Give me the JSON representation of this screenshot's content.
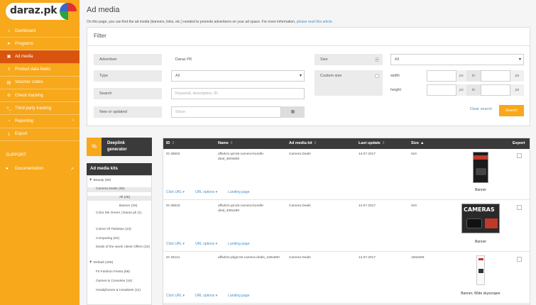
{
  "logo": {
    "text": "daraz.pk"
  },
  "nav": [
    {
      "label": "Dashboard",
      "icon": "home-icon",
      "glyph": "⌂"
    },
    {
      "label": "Programs",
      "icon": "plane-icon",
      "glyph": "➤"
    },
    {
      "label": "Ad media",
      "icon": "image-icon",
      "glyph": "▣",
      "active": true
    },
    {
      "label": "Product data feeds",
      "icon": "database-icon",
      "glyph": "≡"
    },
    {
      "label": "Voucher codes",
      "icon": "ticket-icon",
      "glyph": "▤"
    },
    {
      "label": "Check tracking",
      "icon": "no-entry-icon",
      "glyph": "⊘"
    },
    {
      "label": "Third party tracking",
      "icon": "terminal-icon",
      "glyph": ">_"
    },
    {
      "label": "Reporting",
      "icon": "pie-chart-icon",
      "glyph": "◔",
      "chevron": "‹"
    },
    {
      "label": "Export",
      "icon": "download-icon",
      "glyph": "⤓"
    }
  ],
  "support": {
    "label": "SUPPORT",
    "docs_label": "Documentation",
    "docs_glyph": "●",
    "ext_glyph": "↗"
  },
  "header": {
    "title": "Ad media",
    "intro": "On this page, you can find the ad media (banners, links, etc.) needed to promote advertisers on your ad space. For more information, ",
    "intro_link": "please read this article."
  },
  "filter": {
    "title": "Filter",
    "advertiser_label": "Advertiser",
    "advertiser_value": "Daraz PK",
    "type_label": "Type",
    "type_value": "All",
    "search_label": "Search",
    "search_placeholder": "Keyword, description, ID",
    "new_label": "New or updated",
    "since_placeholder": "Since",
    "size_label": "Size",
    "size_value": "All",
    "custom_size_label": "Custom size",
    "width_label": "width",
    "height_label": "height",
    "px": "px",
    "to": "to",
    "clear": "Clear search",
    "search_button": "Search",
    "caret": "▾",
    "calendar_glyph": "▦"
  },
  "deeplink": {
    "label_1": "Deeplink",
    "label_2": "generator",
    "glyph": "%"
  },
  "kits": {
    "title": "Ad media kits",
    "items": [
      {
        "label": "Beauty (69)",
        "plus": "+"
      },
      {
        "label": "Camera Deals (25)",
        "selected": true
      },
      {
        "label": "All (25)",
        "indent": 2,
        "selected": true
      },
      {
        "label": "Banner (25)",
        "indent": 2
      },
      {
        "label": "Color Me Green | Daraz.pk (1)"
      },
      {
        "label": "Colors Of Pakistan (23)"
      },
      {
        "label": "Computing (64)"
      },
      {
        "label": "Deals of the week | Best Offers (33)"
      },
      {
        "label": "Default (185)",
        "plus": "+"
      },
      {
        "label": "Fit Fashion Fiesta (58)"
      },
      {
        "label": "Games & Consoles (16)"
      },
      {
        "label": "Headphones & Headsets (11)"
      }
    ]
  },
  "table": {
    "headers": {
      "id": "ID",
      "name": "Name",
      "kit": "Ad media kit",
      "updated": "Last update",
      "size": "Size",
      "export": "Export"
    },
    "sort_glyph": "⇕",
    "size_sort_glyph": "▲",
    "links": {
      "click": "Click URL ▾",
      "options": "URL options ▾",
      "landing": "Landing page"
    },
    "rows": [
      {
        "id": "ID 38502",
        "name": "affwk41-gm15-camera-bundle-deal_300x600",
        "kit": "Camera Deals",
        "updated": "14.07.2017",
        "size": "0x0",
        "type": "Banner"
      },
      {
        "id": "ID 38533",
        "name": "affwk41-gm15-camera-bundle-deal_336x280",
        "kit": "Camera Deals",
        "updated": "14.07.2017",
        "size": "0x0",
        "type": "Banner"
      },
      {
        "id": "ID 33121",
        "name": "affwk31-pkgm15-camera-deals_160x600",
        "kit": "Camera Deals",
        "updated": "14.07.2017",
        "size": "160x600",
        "type": "Banner, Wide skyscraper"
      }
    ],
    "thumb2_text": "CAMERAS"
  },
  "colors": {
    "brand": "#f7a81b",
    "active_nav": "#d9550f",
    "link": "#4a90c8",
    "dark_header": "#3a3a3a"
  }
}
